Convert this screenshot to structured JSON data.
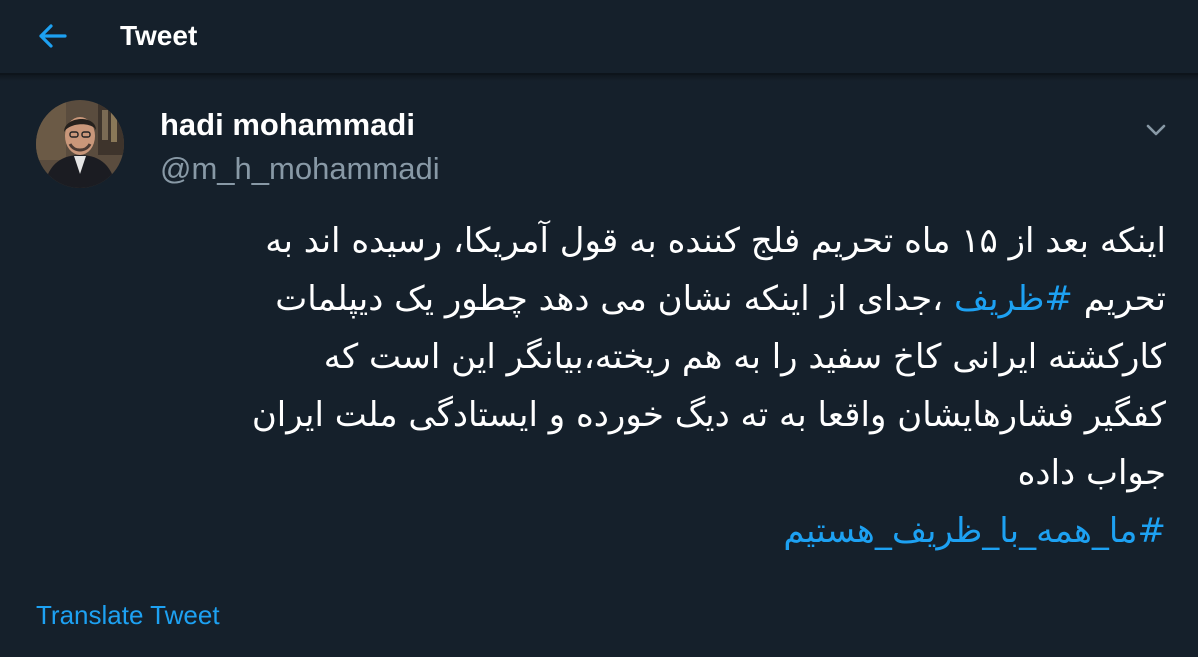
{
  "header": {
    "back_icon": "arrow-left-icon",
    "title": "Tweet"
  },
  "colors": {
    "background": "#15202b",
    "accent": "#1da1f2",
    "secondary_text": "#8899a6"
  },
  "author": {
    "name": "hadi mohammadi",
    "handle": "@m_h_mohammadi",
    "menu_icon": "chevron-down-icon"
  },
  "tweet": {
    "line1": "اینکه بعد از ۱۵ ماه تحریم فلج کننده به قول آمریکا، رسیده اند به",
    "line2_prefix": "تحریم ",
    "line2_hashtag": "#ظریف",
    "line2_suffix": " ،جدای از اینکه نشان می دهد چطور یک دیپلمات",
    "line3": "کارکشته ایرانی کاخ سفید را به هم ریخته،بیانگر این است که",
    "line4": "کفگیر فشارهایشان  واقعا به ته دیگ خورده و ایستادگی ملت ایران",
    "line5": "جواب داده",
    "hashtag2": "#ما_همه_با_ظریف_هستیم"
  },
  "translate_label": "Translate Tweet"
}
